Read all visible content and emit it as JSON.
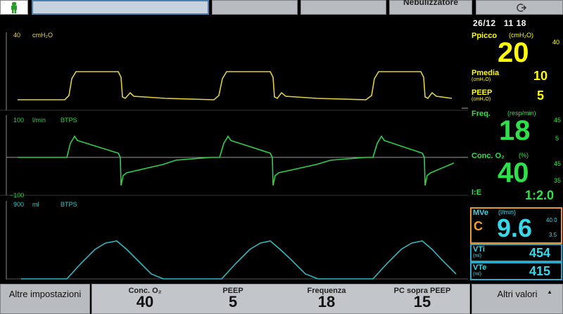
{
  "topbar": {
    "nebulizer_label": "Nebulizzatore"
  },
  "datetime": {
    "date": "26/12",
    "time": "11 18"
  },
  "waveforms": {
    "pressure": {
      "scale_max": "40",
      "unit": "cmH₂O",
      "color": "#e8d84a"
    },
    "flow": {
      "scale_max": "100",
      "unit": "l/min",
      "btps": "BTPS",
      "scale_min": "−100",
      "color": "#2ed04a"
    },
    "volume": {
      "scale_max": "900",
      "unit": "ml",
      "btps": "BTPS",
      "color": "#3ac2c2"
    }
  },
  "monitor": {
    "ppeak": {
      "label": "Ppicco",
      "unit": "(cmH₂O)",
      "value": "20",
      "side": "40"
    },
    "pmean": {
      "label": "Pmedia",
      "unit": "(cmH₂O)",
      "value": "10"
    },
    "peep": {
      "label": "PEEP",
      "unit": "(cmH₂O)",
      "value": "5"
    },
    "freq": {
      "label": "Freq.",
      "unit": "(resp/min)",
      "value": "18",
      "hi": "45",
      "lo": "5"
    },
    "o2": {
      "label": "Conc. O₂",
      "unit": "(%)",
      "value": "40",
      "hi": "45",
      "lo": "35"
    },
    "ie": {
      "label": "I:E",
      "value": "1:2.0"
    },
    "mve": {
      "label": "MVe",
      "unit": "(l/min)",
      "value": "9.6",
      "prefix": "C",
      "hi": "40.0",
      "lo": "3.5"
    },
    "vti": {
      "label": "VTi",
      "unit": "(ml)",
      "value": "454"
    },
    "vte": {
      "label": "VTe",
      "unit": "(ml)",
      "value": "415"
    }
  },
  "bottom": {
    "other_settings": "Altre impostazioni",
    "other_values": "Altri valori",
    "params": [
      {
        "label": "Conc. O₂",
        "value": "40"
      },
      {
        "label": "PEEP",
        "value": "5"
      },
      {
        "label": "Frequenza",
        "value": "18"
      },
      {
        "label": "PC sopra PEEP",
        "value": "15"
      }
    ]
  },
  "colors": {
    "yellow": "#ffff00",
    "green": "#2ee04a",
    "cyan": "#38d8e8",
    "orange": "#f0a030"
  }
}
